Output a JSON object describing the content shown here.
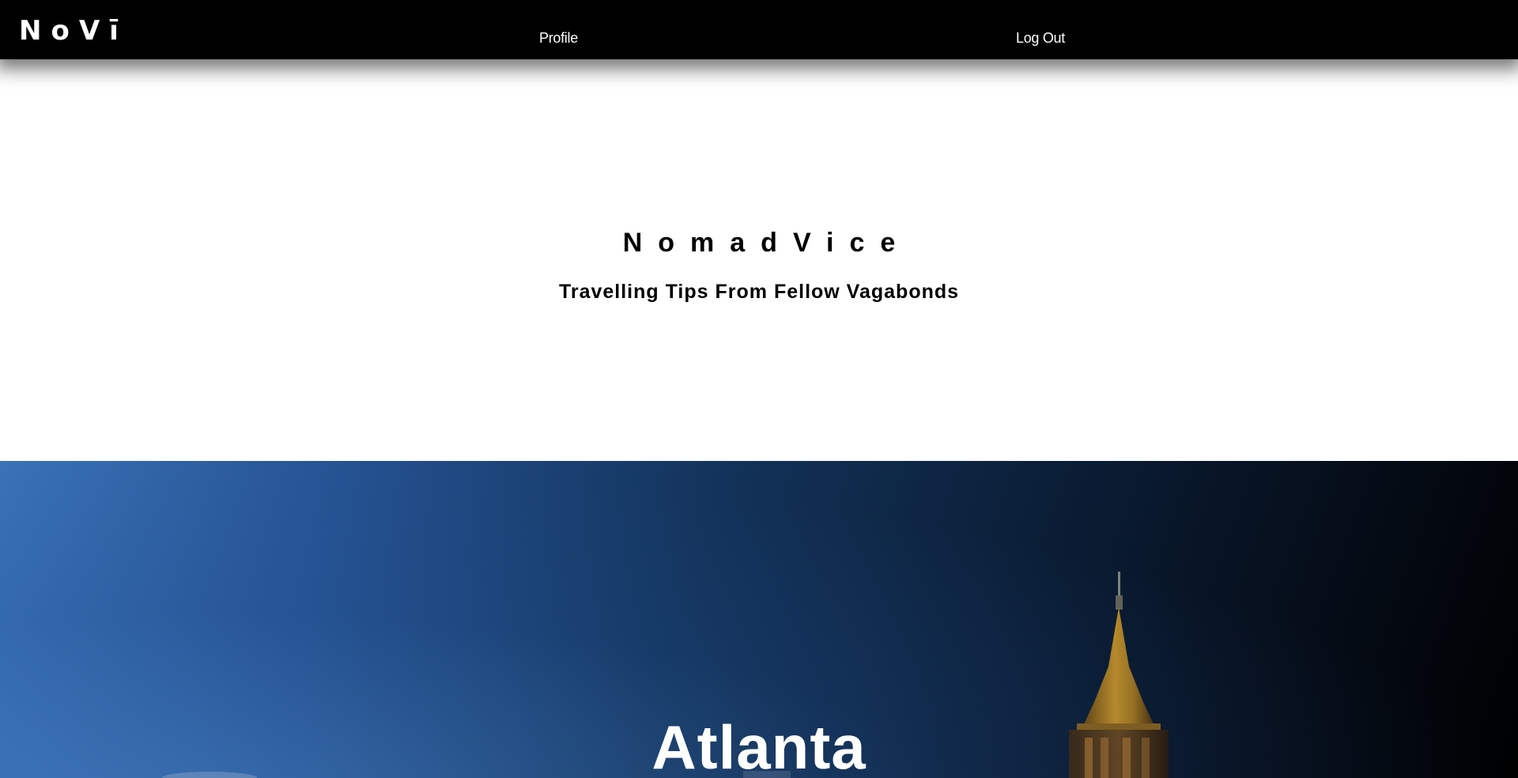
{
  "navbar": {
    "logo": "NoVī",
    "links": {
      "profile": "Profile",
      "logout": "Log Out"
    }
  },
  "hero": {
    "title": "NomadVice",
    "tagline": "Travelling Tips From Fellow Vagabonds"
  },
  "featured_city": {
    "name": "Atlanta"
  },
  "colors": {
    "navbar_bg": "#000000",
    "page_bg": "#ffffff",
    "banner_blue": "#245190",
    "banner_dark": "#000000",
    "building_gold": "#c9962b"
  }
}
